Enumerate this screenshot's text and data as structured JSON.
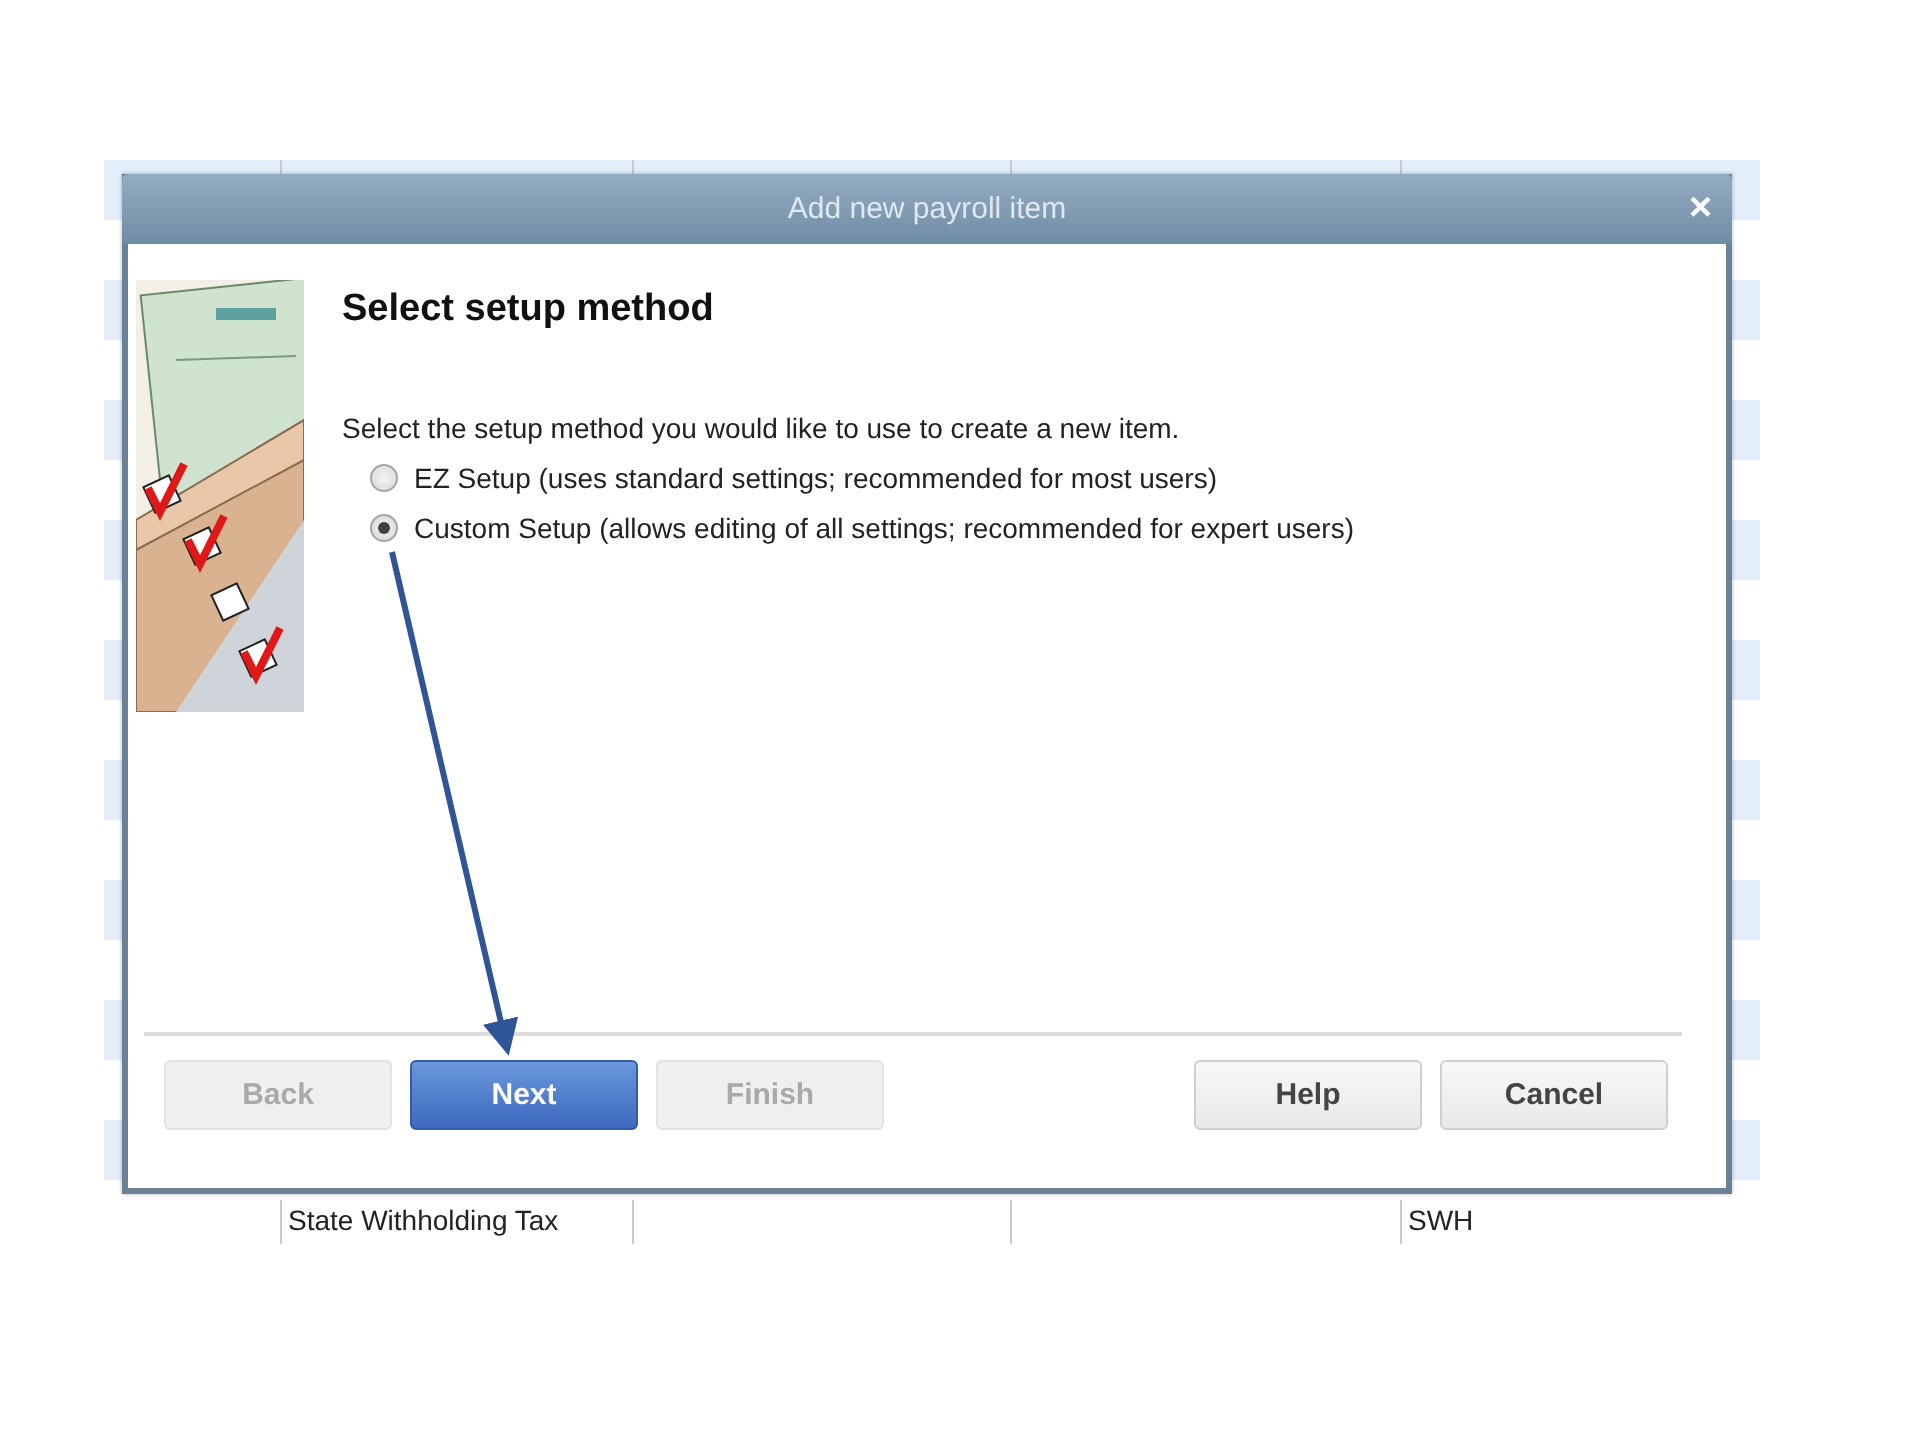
{
  "background_table": {
    "rows": [
      {
        "column_1": "State Withholding Tax",
        "column_2": "SWH"
      }
    ]
  },
  "window": {
    "title": "Add new payroll item",
    "close": "×"
  },
  "heading": "Select setup method",
  "instruction": "Select the setup method you would like to use to create a new item.",
  "options": [
    {
      "label": "EZ Setup (uses standard settings; recommended for most users)",
      "selected": false
    },
    {
      "label": "Custom Setup (allows editing of all settings; recommended for expert users)",
      "selected": true
    }
  ],
  "left_buttons": [
    {
      "label": "Back",
      "disabled": true,
      "default": false
    },
    {
      "label": "Next",
      "disabled": false,
      "default": true
    },
    {
      "label": "Finish",
      "disabled": true,
      "default": false
    }
  ],
  "right_buttons": [
    {
      "label": "Help",
      "disabled": false,
      "default": false
    },
    {
      "label": "Cancel",
      "disabled": false,
      "default": false
    }
  ]
}
